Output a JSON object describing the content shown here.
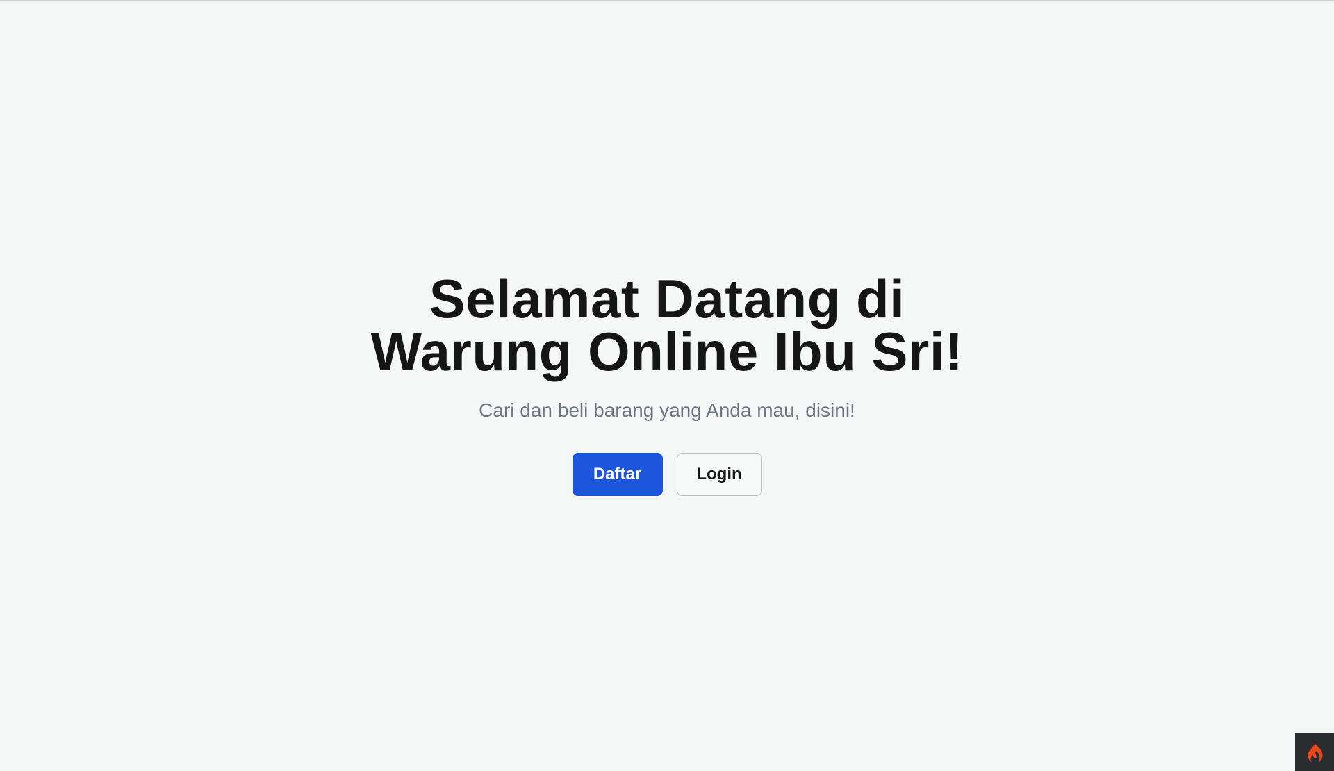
{
  "hero": {
    "title_line1": "Selamat Datang di",
    "title_line2": "Warung Online Ibu Sri!",
    "subtitle": "Cari dan beli barang yang Anda mau, disini!"
  },
  "actions": {
    "register_label": "Daftar",
    "login_label": "Login"
  },
  "corner_badge": {
    "icon": "flame-icon"
  },
  "colors": {
    "background": "#f5f7f7",
    "primary": "#1b56db",
    "title": "#161616",
    "subtitle": "#6b7483",
    "flame": "#e8481d",
    "badge_background": "#2a2d30"
  }
}
